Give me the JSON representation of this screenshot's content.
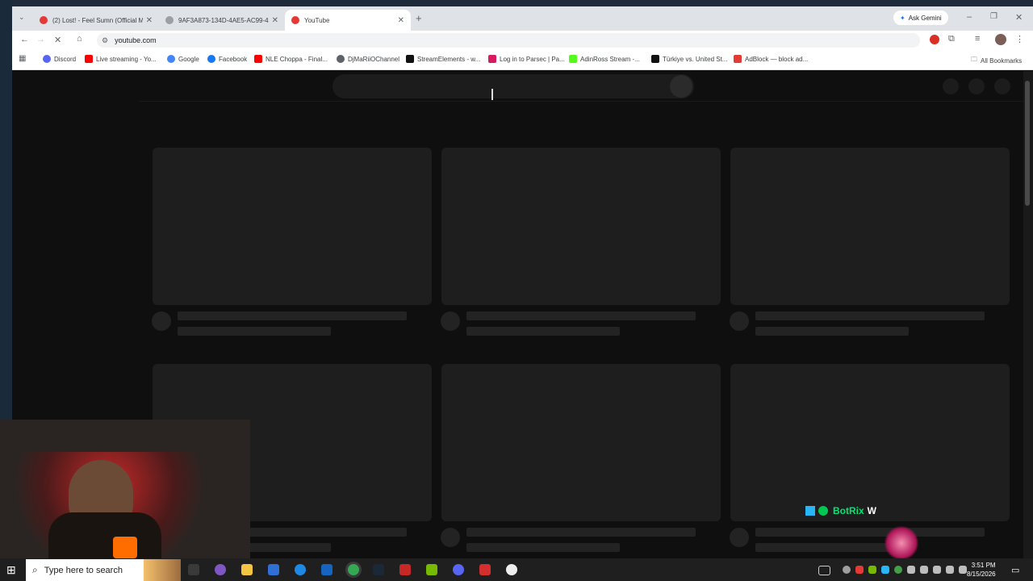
{
  "browser": {
    "tabs": [
      {
        "title": "(2) Lost! - Feel Sumn (Official M",
        "fav_color": "#e53935"
      },
      {
        "title": "9AF3A873-134D-4AE5-AC99-4",
        "fav_color": "#5f6368"
      },
      {
        "title": "YouTube",
        "fav_color": "#e53935"
      }
    ],
    "ask_gemini": "Ask Gemini",
    "address": "youtube.com",
    "bookmarks": [
      {
        "label": "Discord",
        "color": "#5865f2"
      },
      {
        "label": "Live streaming - Yo...",
        "color": "#ff0000"
      },
      {
        "label": "Google",
        "color": "#4285f4"
      },
      {
        "label": "Facebook",
        "color": "#1877f2"
      },
      {
        "label": "NLE Choppa - Final...",
        "color": "#ff0000"
      },
      {
        "label": "DjMaRiiOChannel",
        "color": "#5f6368"
      },
      {
        "label": "StreamElements - w...",
        "color": "#111111"
      },
      {
        "label": "Log in to Parsec | Pa...",
        "color": "#d81b60"
      },
      {
        "label": "AdinRoss Stream -...",
        "color": "#53fc18"
      },
      {
        "label": "Türkiye vs. United St...",
        "color": "#111111"
      },
      {
        "label": "AdBlock — block ad...",
        "color": "#e53935"
      }
    ],
    "all_bookmarks": "All Bookmarks"
  },
  "overlay": {
    "botrix": "BotRix",
    "botrix_suffix": "W"
  },
  "taskbar": {
    "search_placeholder": "Type here to search",
    "time": "3:51 PM",
    "date": "8/15/2026"
  }
}
